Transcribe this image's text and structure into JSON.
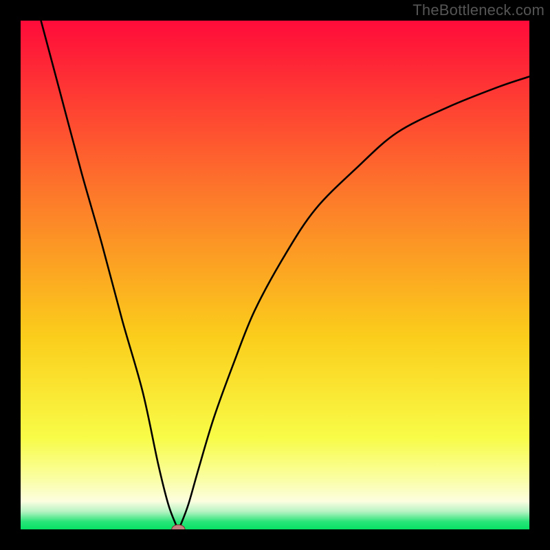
{
  "watermark": "TheBottleneck.com",
  "chart_data": {
    "type": "line",
    "title": "",
    "xlabel": "",
    "ylabel": "",
    "xlim": [
      0,
      100
    ],
    "ylim": [
      0,
      100
    ],
    "grid": false,
    "legend": false,
    "optimum_x": 31,
    "marker": {
      "x": 31,
      "y": 0,
      "color": "#c08080"
    },
    "curve_xy": [
      [
        4,
        100
      ],
      [
        8,
        85
      ],
      [
        12,
        70
      ],
      [
        16,
        56
      ],
      [
        20,
        41
      ],
      [
        24,
        27
      ],
      [
        27,
        13
      ],
      [
        29,
        5
      ],
      [
        30.5,
        1
      ],
      [
        31,
        0
      ],
      [
        31.5,
        1
      ],
      [
        33,
        5
      ],
      [
        35,
        12
      ],
      [
        38,
        22
      ],
      [
        42,
        33
      ],
      [
        46,
        43
      ],
      [
        52,
        54
      ],
      [
        58,
        63
      ],
      [
        66,
        71
      ],
      [
        74,
        78
      ],
      [
        84,
        83
      ],
      [
        94,
        87
      ],
      [
        100,
        89
      ]
    ],
    "background_gradient": [
      {
        "offset": 0.0,
        "color": "#ff0b3a"
      },
      {
        "offset": 0.35,
        "color": "#fd7b2a"
      },
      {
        "offset": 0.62,
        "color": "#fbcd1b"
      },
      {
        "offset": 0.82,
        "color": "#f8fc47"
      },
      {
        "offset": 0.9,
        "color": "#fafea2"
      },
      {
        "offset": 0.945,
        "color": "#fcfee0"
      },
      {
        "offset": 0.965,
        "color": "#b6f3c3"
      },
      {
        "offset": 0.985,
        "color": "#28e578"
      },
      {
        "offset": 1.0,
        "color": "#06e164"
      }
    ]
  }
}
